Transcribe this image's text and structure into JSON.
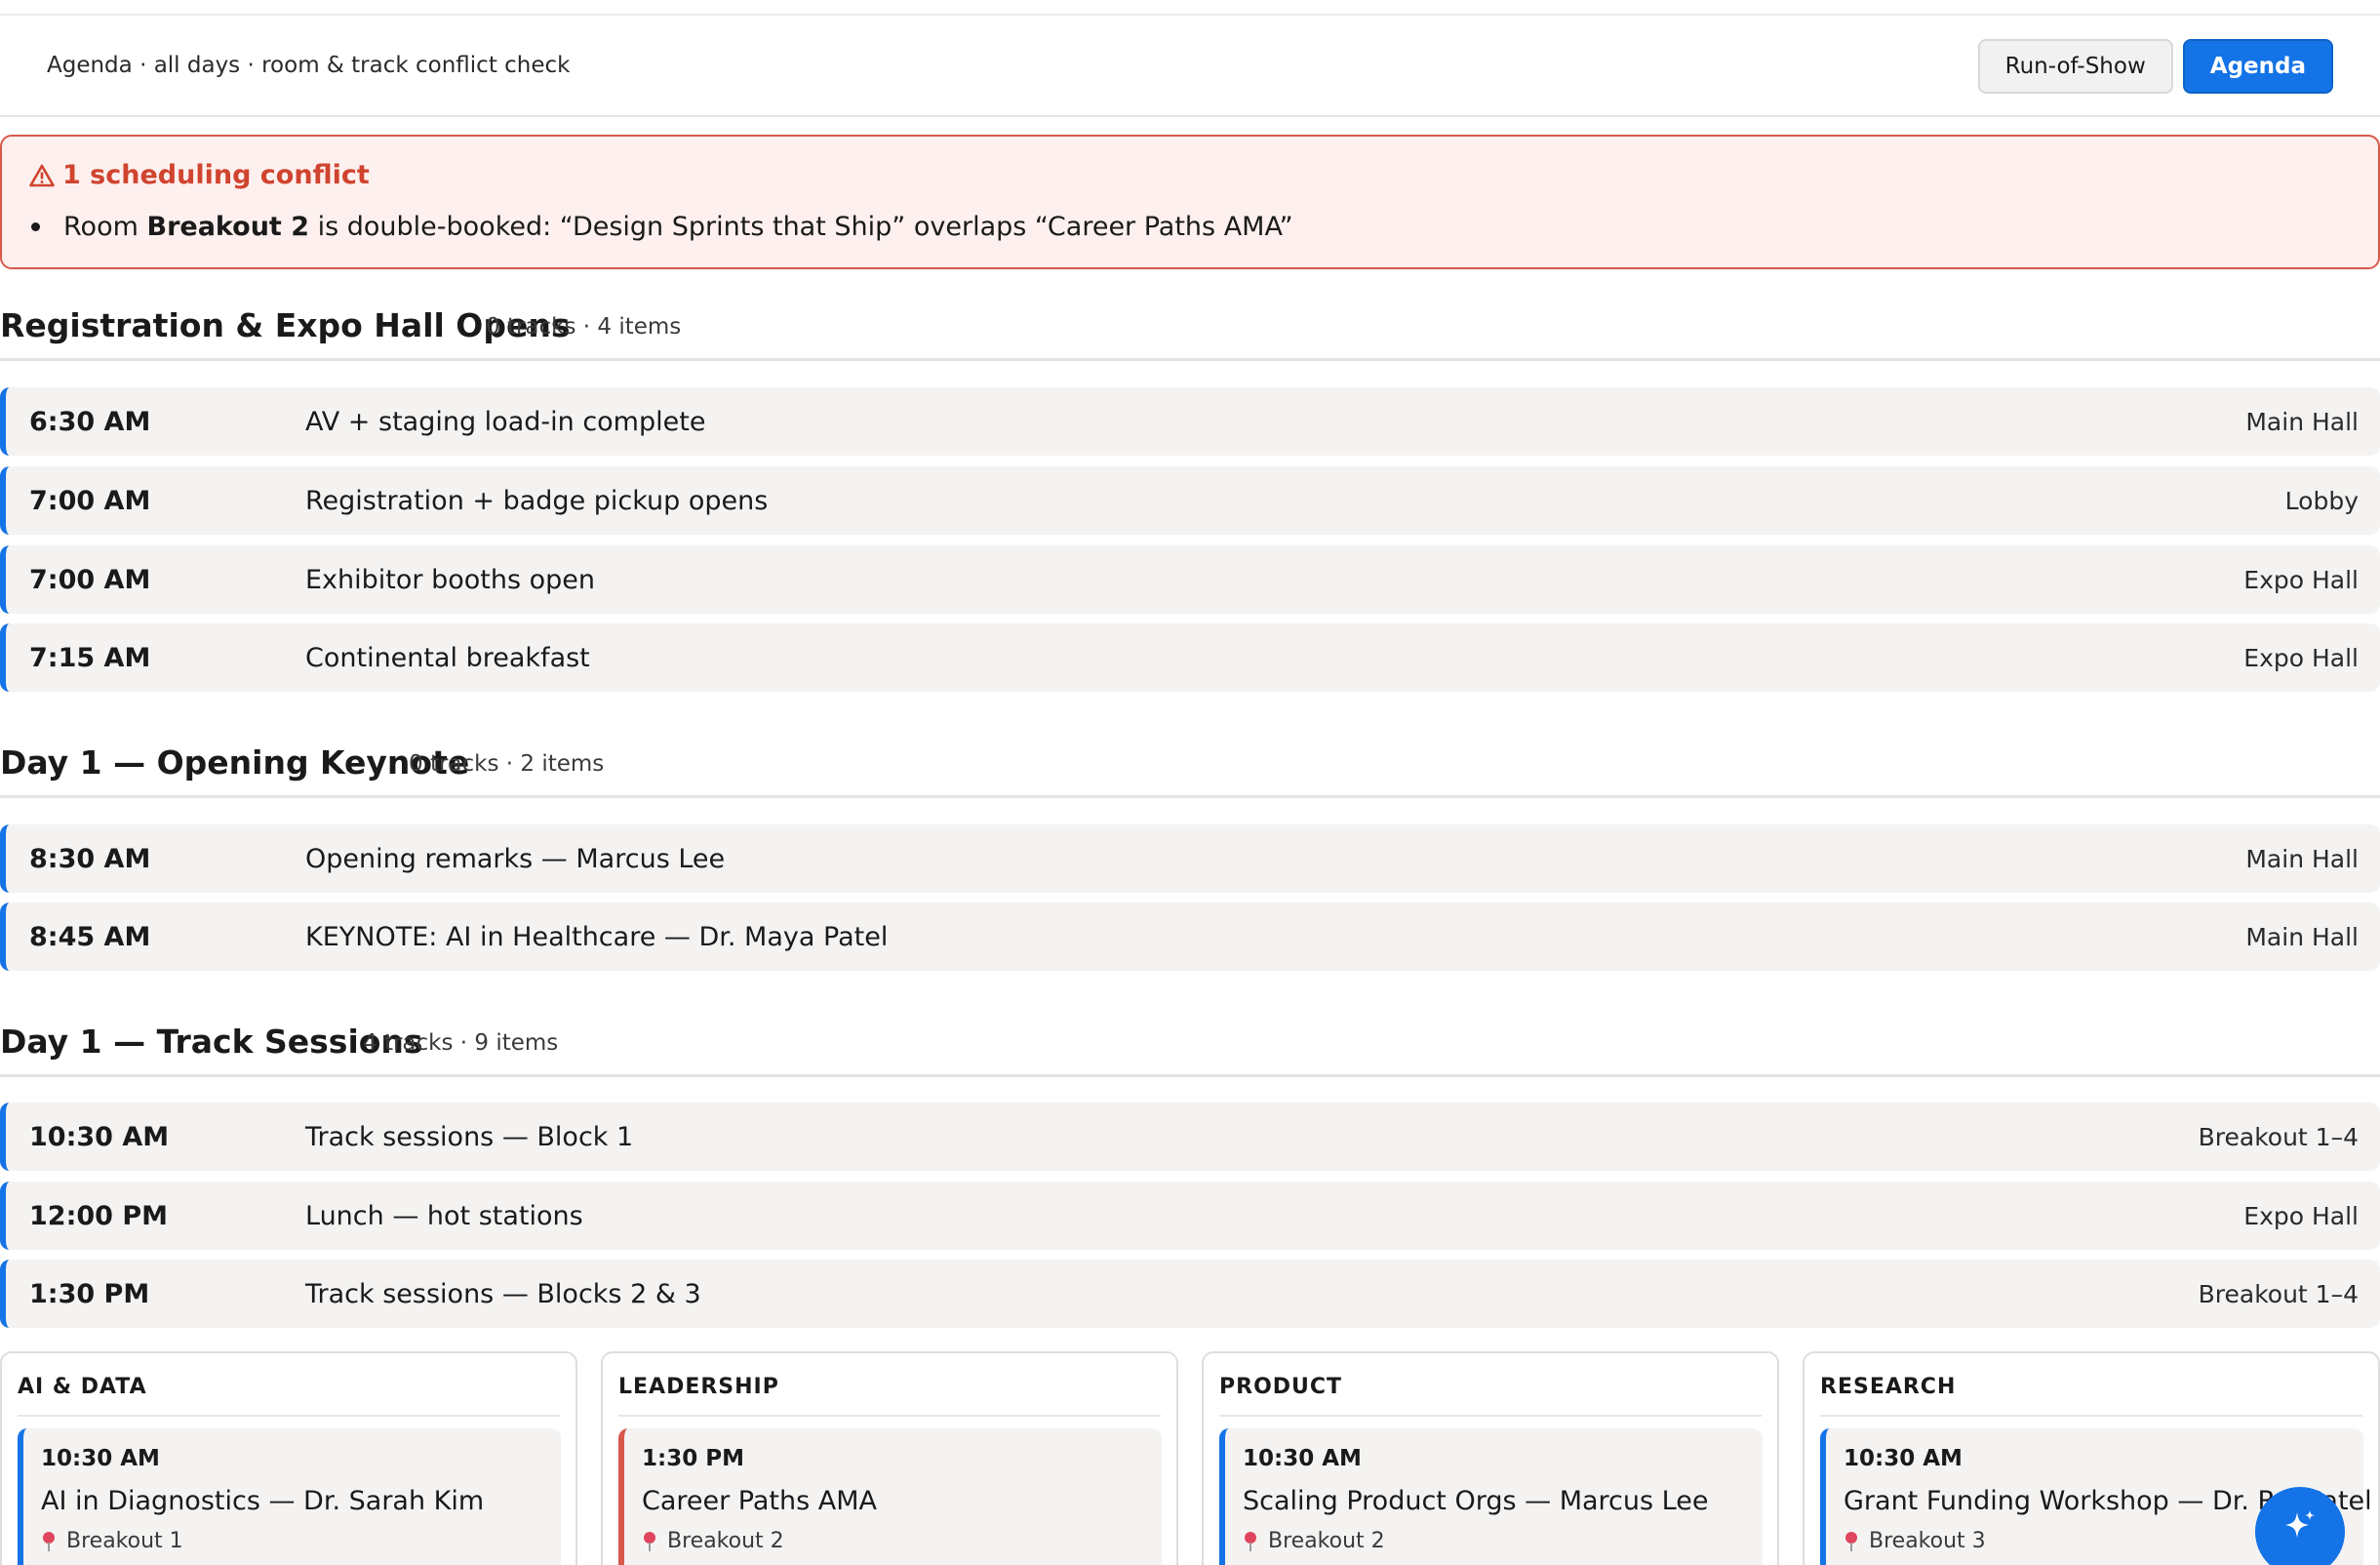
{
  "header": {
    "title": "Agenda · all days · room & track conflict check",
    "buttons": {
      "run_of_show": "Run-of-Show",
      "agenda": "Agenda"
    }
  },
  "conflicts": {
    "title": "1 scheduling conflict",
    "items": [
      {
        "prefix": "Room ",
        "room": "Breakout 2",
        "rest": " is double-booked: “Design Sprints that Ship” overlaps “Career Paths AMA”"
      }
    ]
  },
  "sections": [
    {
      "title": "Registration & Expo Hall Opens",
      "meta": "0 tracks · 4 items",
      "rows": [
        {
          "time": "6:30 AM",
          "label": "AV + staging load-in complete",
          "room": "Main Hall"
        },
        {
          "time": "7:00 AM",
          "label": "Registration + badge pickup opens",
          "room": "Lobby"
        },
        {
          "time": "7:00 AM",
          "label": "Exhibitor booths open",
          "room": "Expo Hall"
        },
        {
          "time": "7:15 AM",
          "label": "Continental breakfast",
          "room": "Expo Hall"
        }
      ]
    },
    {
      "title": "Day 1 — Opening Keynote",
      "meta": "0 tracks · 2 items",
      "rows": [
        {
          "time": "8:30 AM",
          "label": "Opening remarks — Marcus Lee",
          "room": "Main Hall"
        },
        {
          "time": "8:45 AM",
          "label": "KEYNOTE: AI in Healthcare — Dr. Maya Patel",
          "room": "Main Hall"
        }
      ]
    },
    {
      "title": "Day 1 — Track Sessions",
      "meta": "4 tracks · 9 items",
      "rows": [
        {
          "time": "10:30 AM",
          "label": "Track sessions — Block 1",
          "room": "Breakout 1–4"
        },
        {
          "time": "12:00 PM",
          "label": "Lunch — hot stations",
          "room": "Expo Hall"
        },
        {
          "time": "1:30 PM",
          "label": "Track sessions — Blocks 2 & 3",
          "room": "Breakout 1–4"
        }
      ]
    }
  ],
  "tracks": [
    {
      "name": "AI & DATA",
      "session": {
        "time": "10:30 AM",
        "title": "AI in Diagnostics — Dr. Sarah Kim",
        "room": "Breakout 1"
      }
    },
    {
      "name": "LEADERSHIP",
      "session": {
        "time": "1:30 PM",
        "title": "Career Paths AMA",
        "room": "Breakout 2"
      }
    },
    {
      "name": "PRODUCT",
      "session": {
        "time": "10:30 AM",
        "title": "Scaling Product Orgs — Marcus Lee",
        "room": "Breakout 2"
      }
    },
    {
      "name": "RESEARCH",
      "session": {
        "time": "10:30 AM",
        "title": "Grant Funding Workshop — Dr. Raj Patel",
        "room": "Breakout 3"
      }
    }
  ],
  "colors": {
    "accent": "#1473e6",
    "conflict": "#d9594a",
    "row_bg": "#f4f3f2"
  },
  "icons": {
    "alert": "warning-triangle-icon",
    "room": "map-pin-icon",
    "fab": "sparkle-icon"
  }
}
